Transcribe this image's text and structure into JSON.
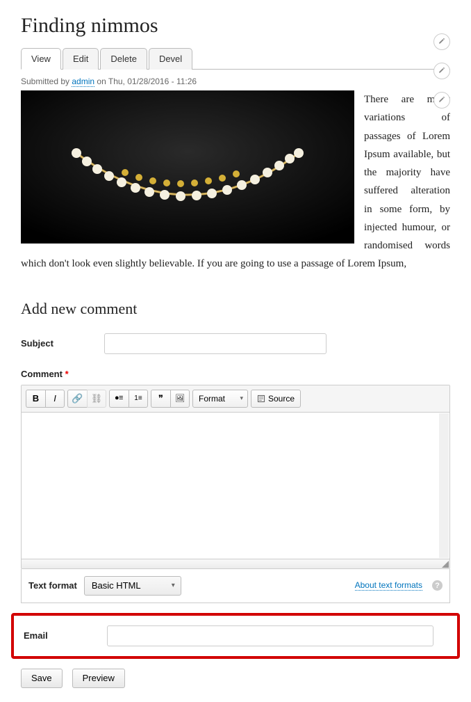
{
  "page": {
    "title": "Finding nimmos"
  },
  "tabs": {
    "view": "View",
    "edit": "Edit",
    "delete": "Delete",
    "devel": "Devel"
  },
  "meta": {
    "submitted_prefix": "Submitted by ",
    "author": "admin",
    "date_prefix": " on ",
    "date": "Thu, 01/28/2016 - 11:26"
  },
  "article": {
    "body": "There are many variations of passages of Lorem Ipsum available, but the majority have suffered alteration in some form, by injected humour, or randomised words which don't look even slightly believable. If you are going to use a passage of Lorem Ipsum,"
  },
  "section": {
    "add_comment": "Add new comment"
  },
  "form": {
    "subject_label": "Subject",
    "comment_label": "Comment",
    "required_mark": "*",
    "email_label": "Email",
    "text_format_label": "Text format",
    "text_format_value": "Basic HTML",
    "about_formats": "About text formats",
    "help_mark": "?",
    "format_dropdown": "Format",
    "source_label": "Source",
    "save": "Save",
    "preview": "Preview"
  }
}
